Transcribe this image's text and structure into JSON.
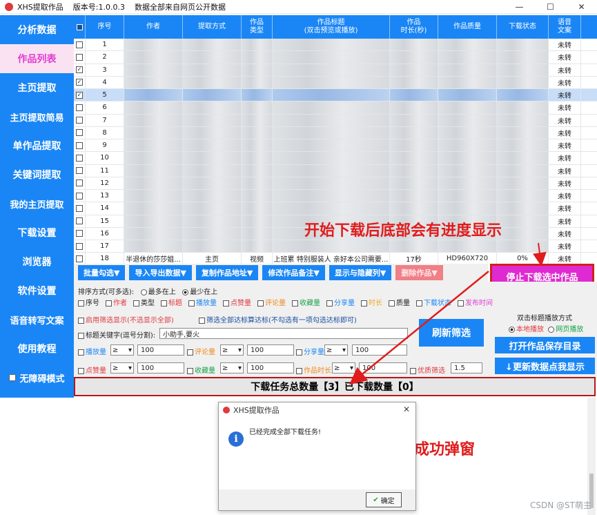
{
  "titlebar": {
    "app_name": "XHS提取作品",
    "version": "版本号:1.0.0.3",
    "note": "数据全部来自网页公开数据",
    "min": "—",
    "max": "☐",
    "close": "✕"
  },
  "sidebar": {
    "items": [
      {
        "label": "分析数据"
      },
      {
        "label": "作品列表"
      },
      {
        "label": "主页提取"
      },
      {
        "label": "主页提取简易"
      },
      {
        "label": "单作品提取"
      },
      {
        "label": "关键词提取"
      },
      {
        "label": "我的主页提取"
      },
      {
        "label": "下载设置"
      },
      {
        "label": "浏览器"
      },
      {
        "label": "软件设置"
      },
      {
        "label": "语音转写文案"
      },
      {
        "label": "使用教程"
      }
    ],
    "accessibility_mode": "无障碍模式"
  },
  "table": {
    "headers": [
      "序号",
      "作者",
      "提取方式",
      "作品\n类型",
      "作品标题\n(双击预览或播放)",
      "作品\n时长(秒)",
      "作品质量",
      "下载状态",
      "语音\n文案"
    ],
    "row_numbers": [
      "1",
      "2",
      "3",
      "4",
      "5",
      "6",
      "7",
      "8",
      "9",
      "10",
      "11",
      "12",
      "13",
      "14",
      "15",
      "16",
      "17",
      "18"
    ],
    "checked_rows": [
      3,
      4,
      5
    ],
    "selected_row": 5,
    "status_label": "未转",
    "last_row": {
      "author": "半退休的莎莎姐...",
      "method": "主页",
      "type": "视频",
      "title": "上班累 特别服装人 亲好本公司需要...",
      "duration": "17秒",
      "quality": "HD960X720",
      "download": "0%",
      "voice": "未转"
    }
  },
  "toolbar": {
    "buttons": [
      "批量勾选▼",
      "导入导出数据▼",
      "复制作品地址▼",
      "修改作品备注▼",
      "显示与隐藏列▼",
      "删除作品▼"
    ],
    "stop": "停止下载选中作品"
  },
  "sort": {
    "label": "排序方式(可多选):",
    "newest": "最多在上",
    "oldest": "最少在上",
    "fields": [
      {
        "label": "序号",
        "color": "#222222"
      },
      {
        "label": "作者",
        "color": "#e0393e"
      },
      {
        "label": "类型",
        "color": "#222222"
      },
      {
        "label": "标题",
        "color": "#e0393e"
      },
      {
        "label": "播放量",
        "color": "#1a86f5"
      },
      {
        "label": "点赞量",
        "color": "#e0393e"
      },
      {
        "label": "评论量",
        "color": "#f08a1c"
      },
      {
        "label": "收藏量",
        "color": "#19a34a"
      },
      {
        "label": "分享量",
        "color": "#1a86f5"
      },
      {
        "label": "时长",
        "color": "#f0a81c"
      },
      {
        "label": "质量",
        "color": "#222222"
      },
      {
        "label": "下载状态",
        "color": "#1a86f5"
      },
      {
        "label": "发布时间",
        "color": "#e23bd2"
      }
    ]
  },
  "filter": {
    "enable": "启用筛选显示(不选显示全部)",
    "all_match": "筛选全部达标算达标(不勾选有一项勾选达标即可)",
    "keyword_label": "标题关键字(逗号分割):",
    "keyword_value": "小助手,要火",
    "op": "≥",
    "r1": [
      {
        "label": "播放量",
        "value": "100",
        "color": "#1a86f5"
      },
      {
        "label": "评论量",
        "value": "100",
        "color": "#f08a1c"
      },
      {
        "label": "分享量",
        "value": "100",
        "color": "#1a86f5"
      }
    ],
    "r2": [
      {
        "label": "点赞量",
        "value": "100",
        "color": "#e0393e"
      },
      {
        "label": "收藏量",
        "value": "100",
        "color": "#19a34a"
      },
      {
        "label": "作品时长",
        "value": "100",
        "color": "#f08a1c"
      }
    ],
    "quality_label": "优质筛选",
    "quality_value": "1.5",
    "refresh": "刷新筛选"
  },
  "right_panel": {
    "dblclick_label": "双击标题播放方式",
    "local": "本地播放",
    "web": "网页播放",
    "open_dir": "打开作品保存目录",
    "update": "↓更新数据点我显示"
  },
  "summary": "下载任务总数量【3】已下载数量【0】",
  "annotations": {
    "progress": "开始下载后底部会有进度显示",
    "popup": "下载成功弹窗"
  },
  "dialog": {
    "title": "XHS提取作品",
    "message": "已经完成全部下载任务!",
    "ok": "确定",
    "close": "✕",
    "info": "i"
  },
  "watermark": "CSDN @ST萌主"
}
